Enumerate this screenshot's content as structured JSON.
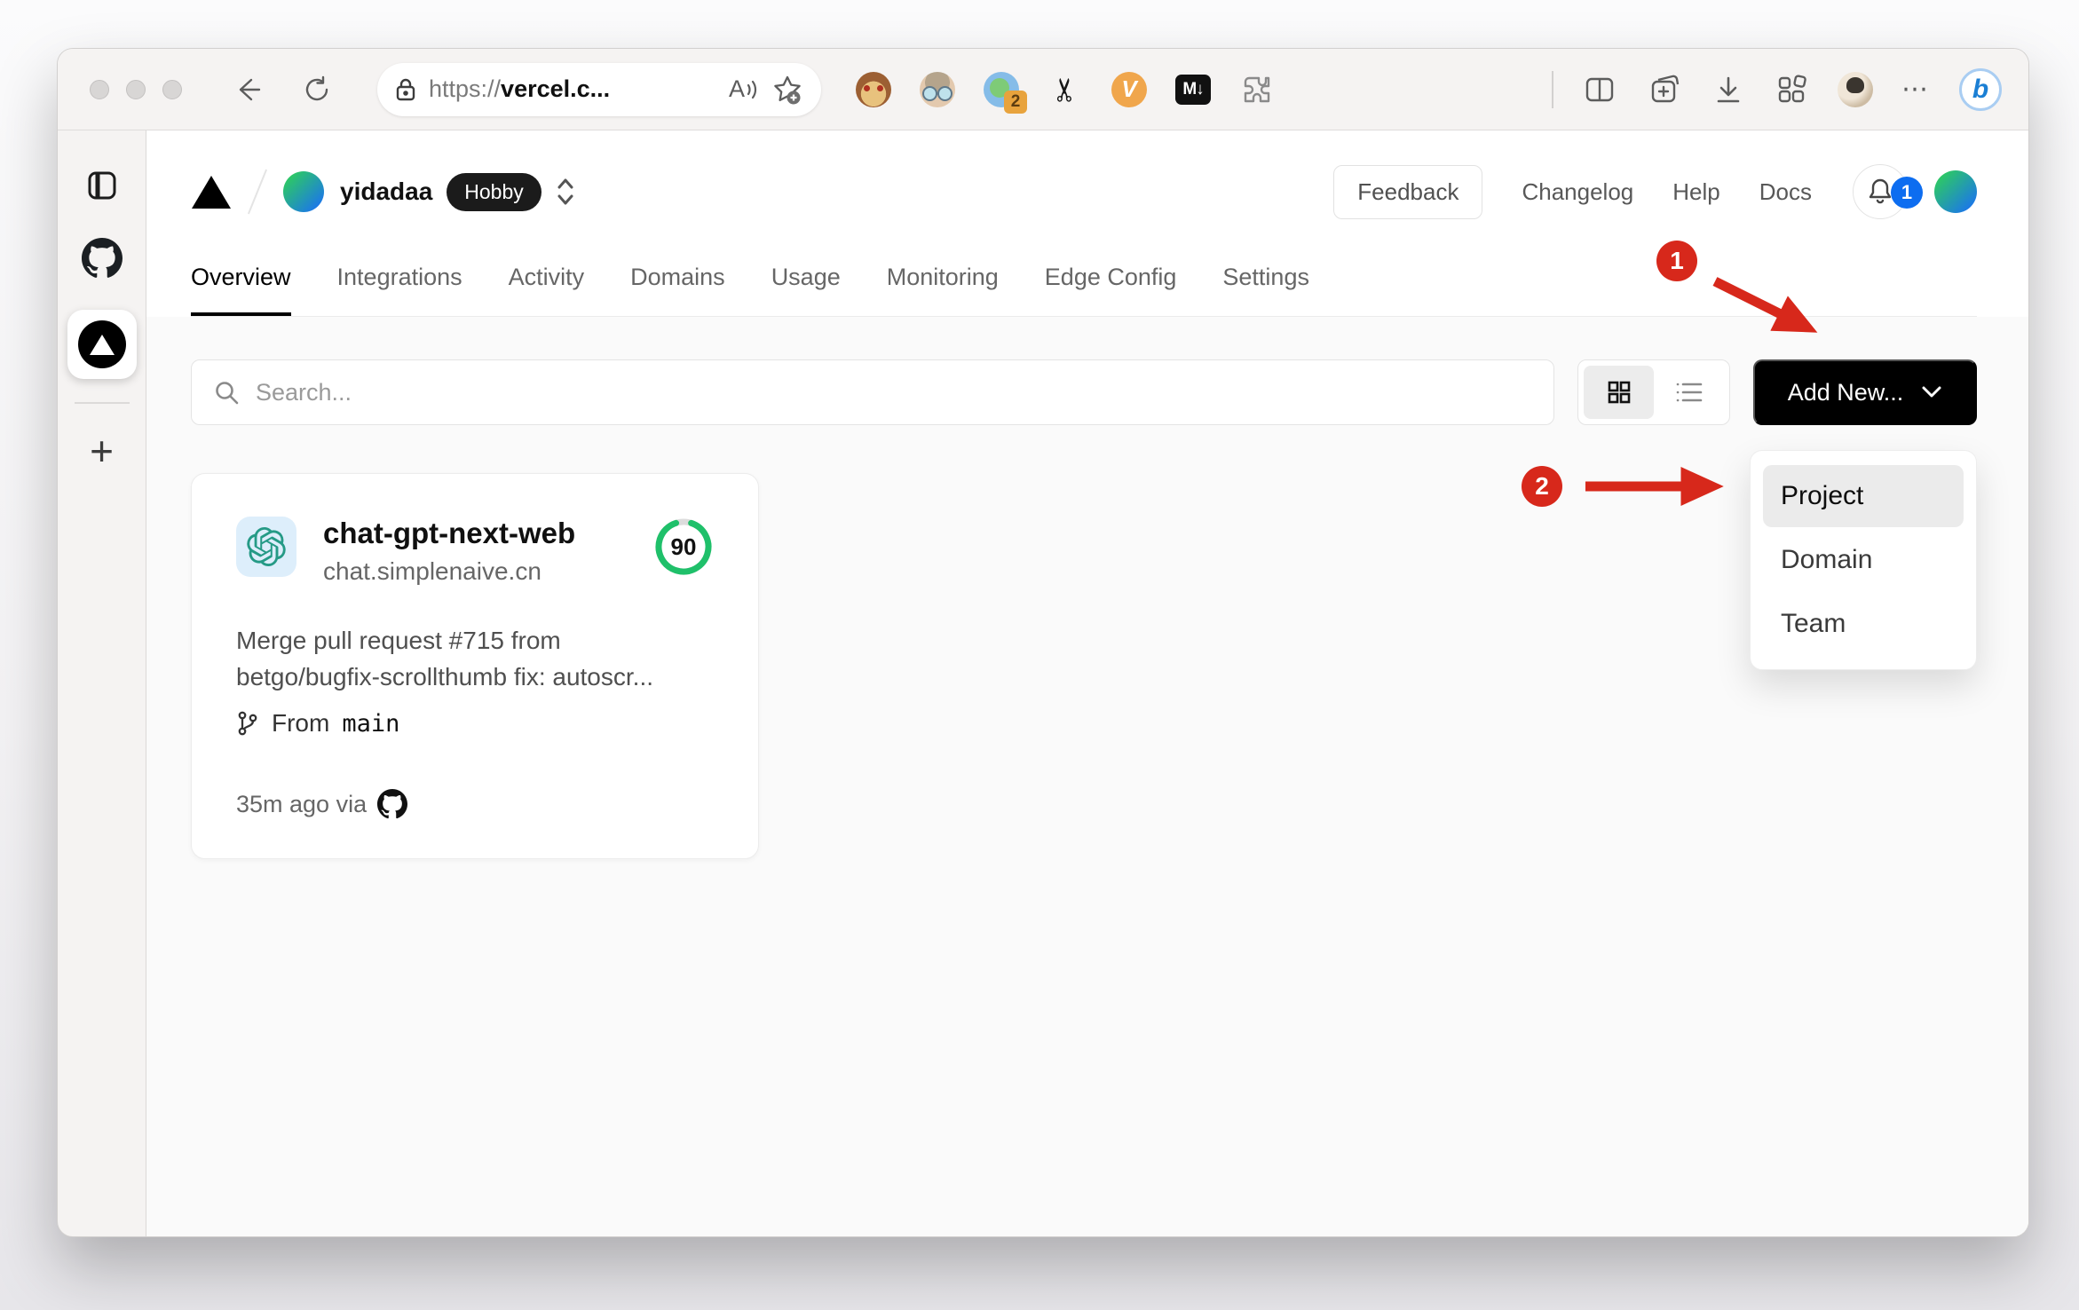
{
  "browser": {
    "url": {
      "protocol": "https://",
      "host": "vercel.c..."
    },
    "read_aloud_glyph": "A",
    "extensions": {
      "translate_badge_count": "2",
      "scissors_glyph": "✂",
      "video_label": "V",
      "markdown_label": "M↓"
    },
    "more_glyph": "⋯",
    "bing_letter": "b"
  },
  "tabstrip": {
    "new_tab_glyph": "+"
  },
  "dashboard": {
    "team": {
      "name": "yidadaa",
      "plan": "Hobby"
    },
    "header": {
      "feedback": "Feedback",
      "changelog": "Changelog",
      "help": "Help",
      "docs": "Docs",
      "notification_count": "1"
    },
    "tabs": [
      "Overview",
      "Integrations",
      "Activity",
      "Domains",
      "Usage",
      "Monitoring",
      "Edge Config",
      "Settings"
    ],
    "search": {
      "placeholder": "Search..."
    },
    "add_new": {
      "label": "Add New..."
    },
    "dropdown": {
      "items": [
        "Project",
        "Domain",
        "Team"
      ],
      "selected": "Project"
    },
    "card": {
      "name": "chat-gpt-next-web",
      "domain": "chat.simplenaive.cn",
      "score": "90",
      "commit_line1": "Merge pull request #715 from",
      "commit_line2": "betgo/bugfix-scrollthumb fix: autoscr...",
      "branch_prefix": "From",
      "branch_name": "main",
      "meta": "35m ago via"
    },
    "annotations": {
      "step1": "1",
      "step2": "2"
    }
  },
  "colors": {
    "annotation_red": "#d7281b",
    "notification_blue": "#0d6df0",
    "score_green": "#1fc06a",
    "brand_black": "#000000",
    "openai_teal": "#259a86",
    "avatar_gradient": [
      "#2ecc5e",
      "#1b74ee"
    ]
  }
}
